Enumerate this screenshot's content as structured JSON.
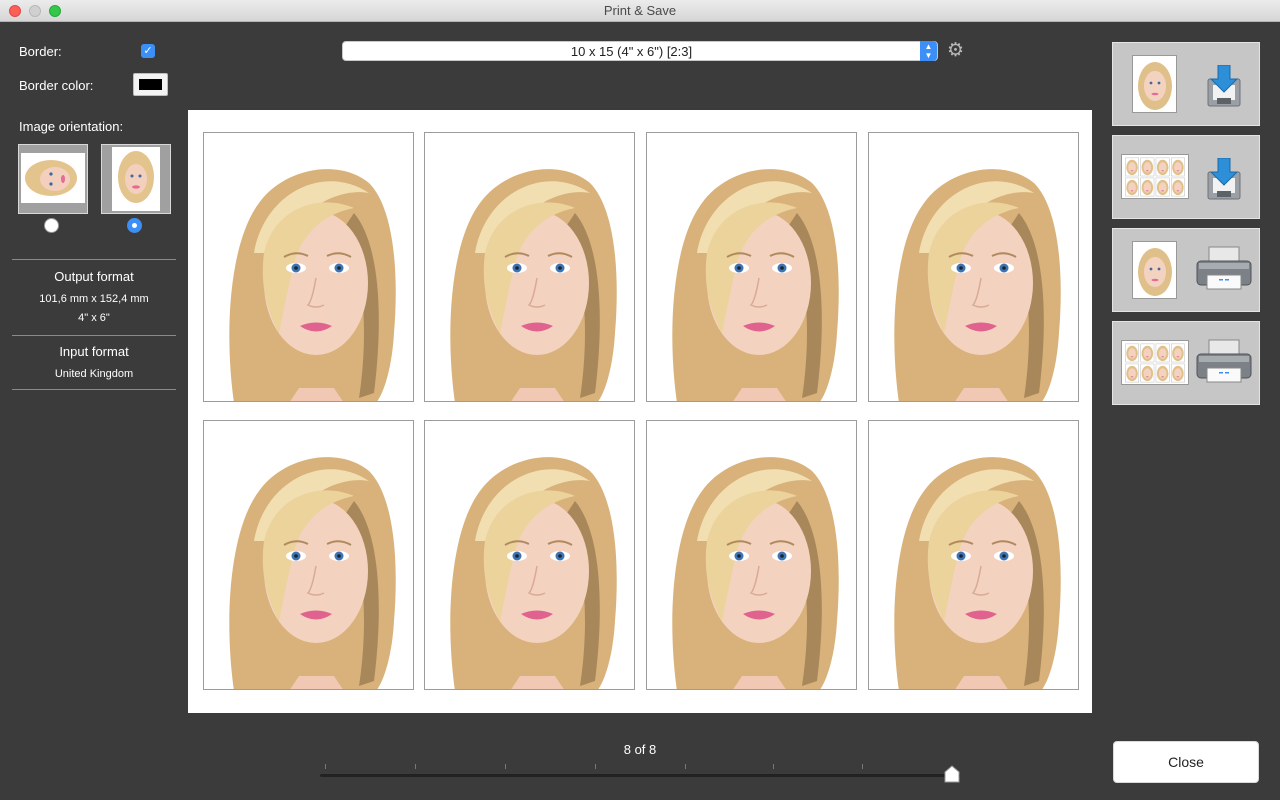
{
  "window": {
    "title": "Print & Save"
  },
  "options": {
    "border_label": "Border:",
    "border_checked": true,
    "border_color_label": "Border color:",
    "border_color": "#000000",
    "orientation_label": "Image orientation:",
    "orientation_selected": "portrait"
  },
  "output_format": {
    "title": "Output format",
    "metric": "101,6 mm x 152,4 mm",
    "imperial": "4\" x 6\""
  },
  "input_format": {
    "title": "Input format",
    "value": "United Kingdom"
  },
  "paper_select": {
    "value": "10 x 15 (4\" x 6\") [2:3]"
  },
  "preview": {
    "photo_count": 8
  },
  "pager": {
    "label": "8 of 8",
    "slider_value": 8,
    "slider_max": 8
  },
  "actions": {
    "save_single": "save-single-photo",
    "save_sheet": "save-photo-sheet",
    "print_single": "print-single-photo",
    "print_sheet": "print-photo-sheet"
  },
  "close_label": "Close",
  "colors": {
    "accent": "#3b8ff6",
    "background": "#3b3b3b"
  }
}
